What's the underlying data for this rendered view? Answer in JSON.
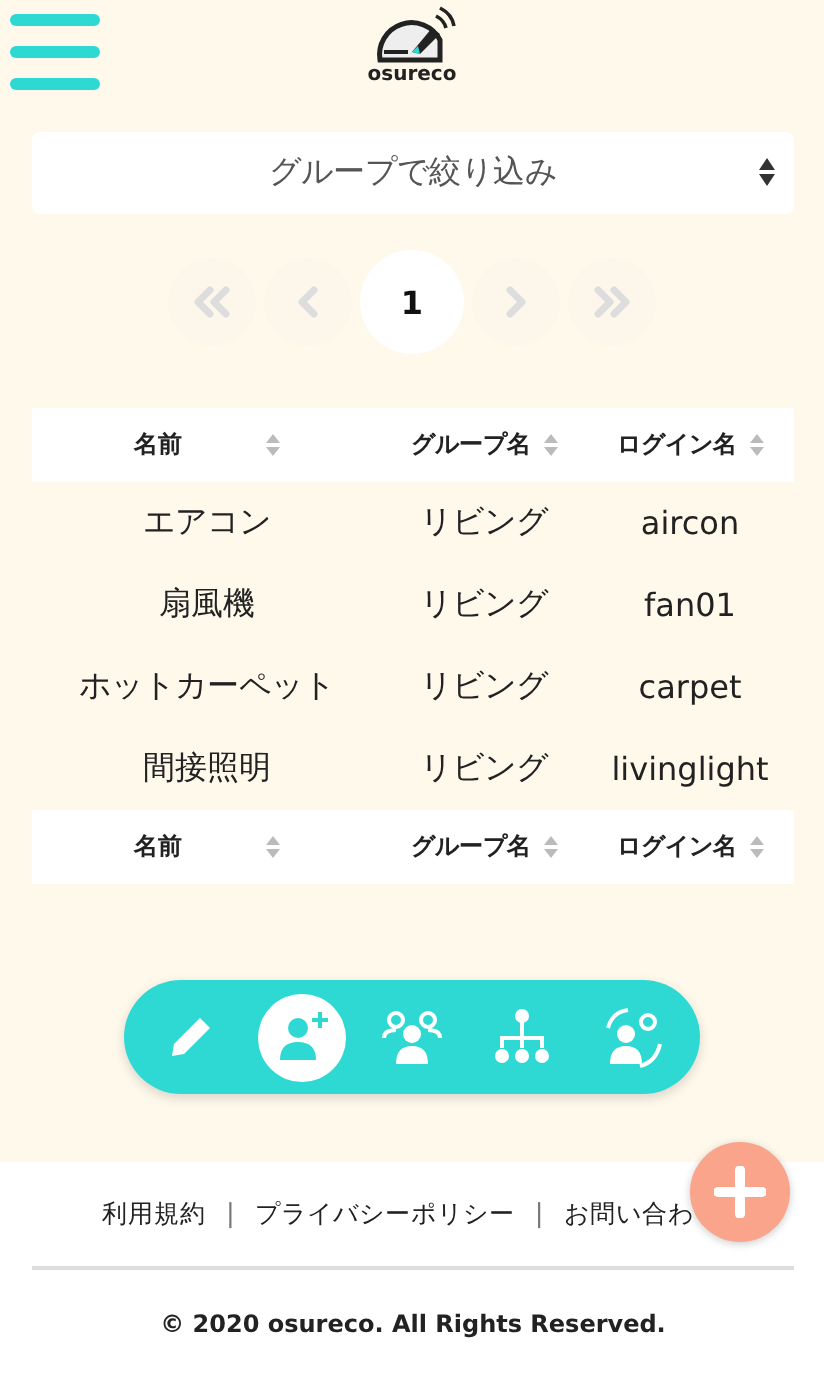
{
  "header": {
    "logo_text": "osureco"
  },
  "group_filter": {
    "value": "グループで絞り込み"
  },
  "pagination": [
    {
      "kind": "first",
      "disabled": true,
      "selected": false
    },
    {
      "kind": "prev",
      "disabled": true,
      "selected": false
    },
    {
      "kind": "page",
      "label": "1",
      "disabled": false,
      "selected": true
    },
    {
      "kind": "next",
      "disabled": true,
      "selected": false
    },
    {
      "kind": "last",
      "disabled": true,
      "selected": false
    }
  ],
  "table": {
    "columns": [
      "名前",
      "グループ名",
      "ログイン名"
    ],
    "rows": [
      [
        "エアコン",
        "リビング",
        "aircon"
      ],
      [
        "扇風機",
        "リビング",
        "fan01"
      ],
      [
        "ホットカーペット",
        "リビング",
        "carpet"
      ],
      [
        "間接照明",
        "リビング",
        "livinglight"
      ]
    ],
    "footer_columns": [
      "名前",
      "グループ名",
      "ログイン名"
    ]
  },
  "toolbar": [
    {
      "kind": "edit",
      "selected": false
    },
    {
      "kind": "add-user",
      "selected": true
    },
    {
      "kind": "group",
      "selected": false
    },
    {
      "kind": "hierarchy",
      "selected": false
    },
    {
      "kind": "switch-user",
      "selected": false
    }
  ],
  "footer": {
    "items": [
      {
        "kind": "link",
        "text": "利用規約"
      },
      {
        "kind": "separator",
        "text": "|"
      },
      {
        "kind": "link",
        "text": "プライバシーポリシー"
      },
      {
        "kind": "separator",
        "text": "|"
      },
      {
        "kind": "link",
        "text": "お問い合わ"
      }
    ],
    "copyright": "© 2020 osureco. All Rights Reserved."
  }
}
